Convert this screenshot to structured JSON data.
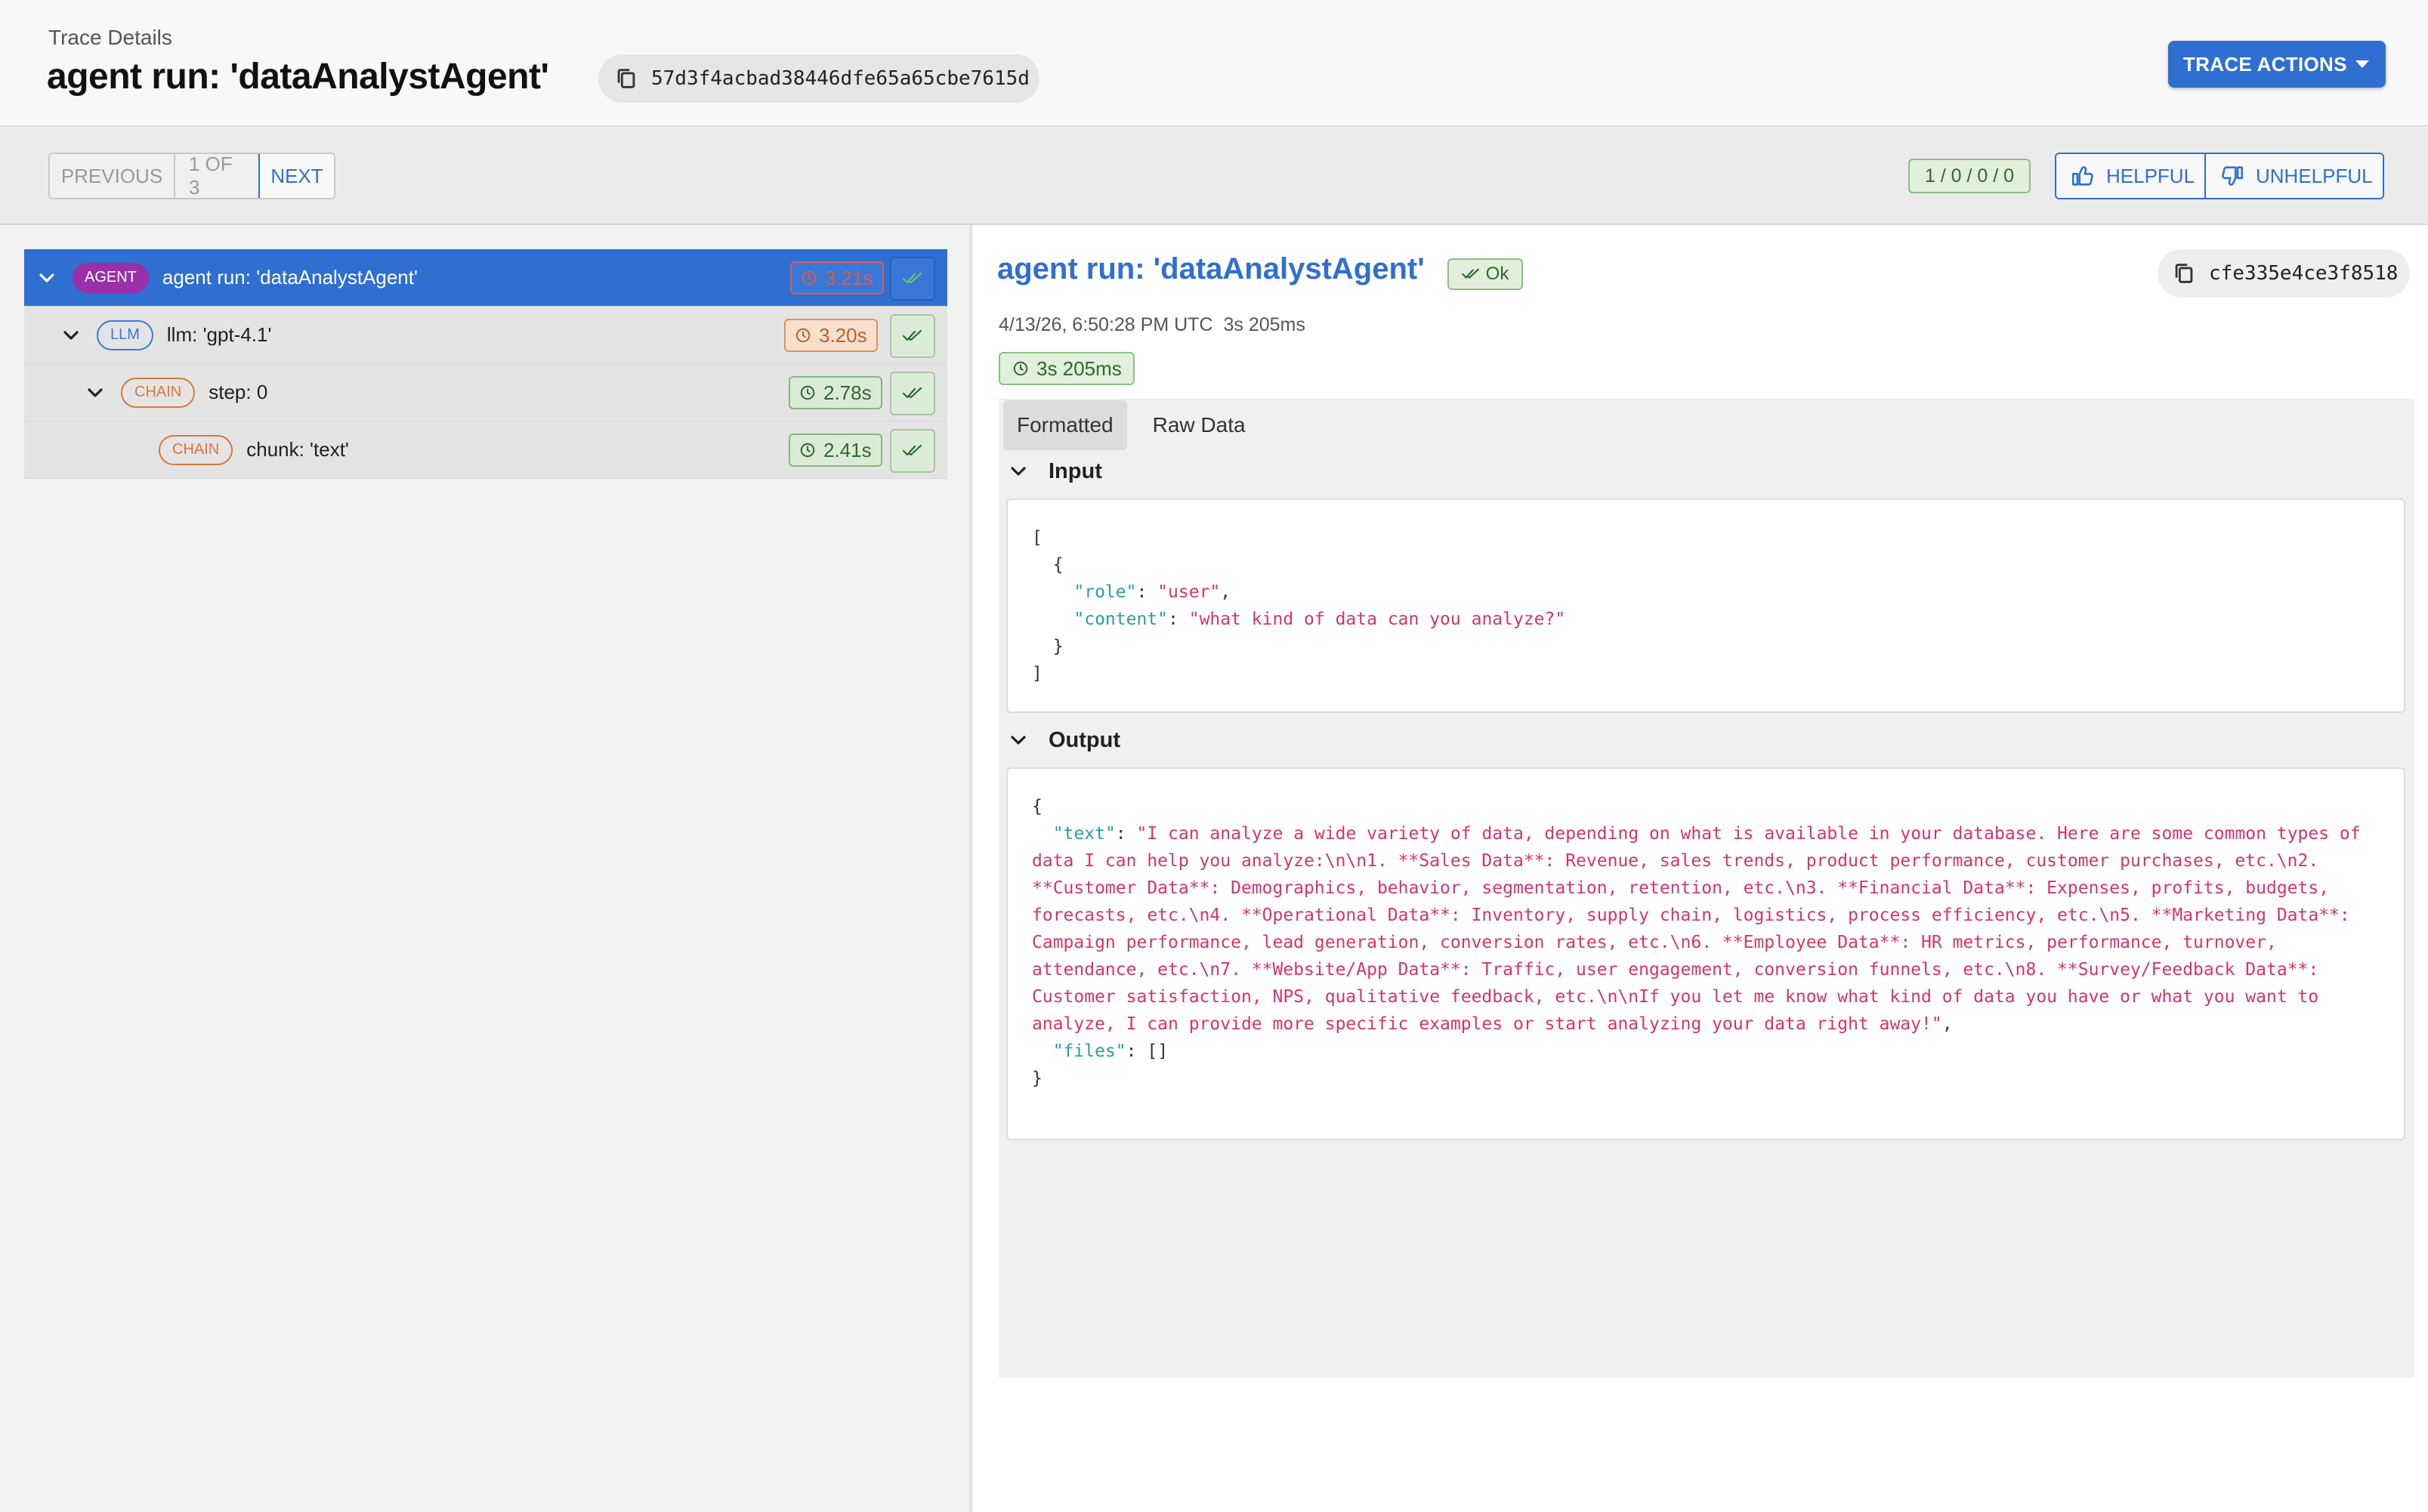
{
  "header": {
    "breadcrumb": "Trace Details",
    "title": "agent run: 'dataAnalystAgent'",
    "trace_id": "57d3f4acbad38446dfe65a65cbe7615d",
    "actions_label": "TRACE ACTIONS"
  },
  "toolbar": {
    "previous_label": "PREVIOUS",
    "page_label": "1 OF 3",
    "next_label": "NEXT",
    "score": "1 / 0 / 0 / 0",
    "helpful_label": "HELPFUL",
    "unhelpful_label": "UNHELPFUL"
  },
  "tree": [
    {
      "kind": "AGENT",
      "label": "agent run: 'dataAnalystAgent'",
      "duration": "3.21s",
      "status": "ok"
    },
    {
      "kind": "LLM",
      "label": "llm: 'gpt-4.1'",
      "duration": "3.20s",
      "status": "ok"
    },
    {
      "kind": "CHAIN",
      "label": "step: 0",
      "duration": "2.78s",
      "status": "ok"
    },
    {
      "kind": "CHAIN",
      "label": "chunk: 'text'",
      "duration": "2.41s",
      "status": "ok"
    }
  ],
  "detail": {
    "title": "agent run: 'dataAnalystAgent'",
    "status_label": "Ok",
    "span_id": "cfe335e4ce3f8518",
    "timestamp": "4/13/26, 6:50:28 PM UTC",
    "duration_text": "3s 205ms",
    "latency_badge": "3s 205ms",
    "tabs": [
      "Formatted",
      "Raw Data"
    ],
    "input_heading": "Input",
    "output_heading": "Output",
    "input_code": {
      "l0": "[",
      "l1": "  {",
      "role_key": "\"role\"",
      "role_val": "\"user\"",
      "content_key": "\"content\"",
      "content_val": "\"what kind of data can you analyze?\"",
      "l4": "  }",
      "l5": "]"
    },
    "output_code": {
      "open": "{",
      "text_key": "\"text\"",
      "text_val": "\"I can analyze a wide variety of data, depending on what is available in your database. Here are some common types of data I can help you analyze:\\n\\n1. **Sales Data**: Revenue, sales trends, product performance, customer purchases, etc.\\n2. **Customer Data**: Demographics, behavior, segmentation, retention, etc.\\n3. **Financial Data**: Expenses, profits, budgets, forecasts, etc.\\n4. **Operational Data**: Inventory, supply chain, logistics, process efficiency, etc.\\n5. **Marketing Data**: Campaign performance, lead generation, conversion rates, etc.\\n6. **Employee Data**: HR metrics, performance, turnover, attendance, etc.\\n7. **Website/App Data**: Traffic, user engagement, conversion funnels, etc.\\n8. **Survey/Feedback Data**: Customer satisfaction, NPS, qualitative feedback, etc.\\n\\nIf you let me know what kind of data you have or what you want to analyze, I can provide more specific examples or start analyzing your data right away!\"",
      "files_key": "\"files\"",
      "files_val": "[]",
      "close": "}"
    }
  },
  "colors": {
    "accent": "#2f6fd1",
    "agent": "#9a2fa8",
    "llm": "#3a7bd5",
    "chain": "#d9773a",
    "ok": "#2e6a2a",
    "string": "#d6336c",
    "key": "#2a9d9d"
  },
  "icons": {
    "copy": "copy-icon",
    "caret": "caret-down-icon",
    "thumb_up": "thumbs-up-icon",
    "thumb_down": "thumbs-down-icon",
    "chevron": "chevron-down-icon",
    "clock": "clock-icon",
    "check": "double-check-icon"
  }
}
